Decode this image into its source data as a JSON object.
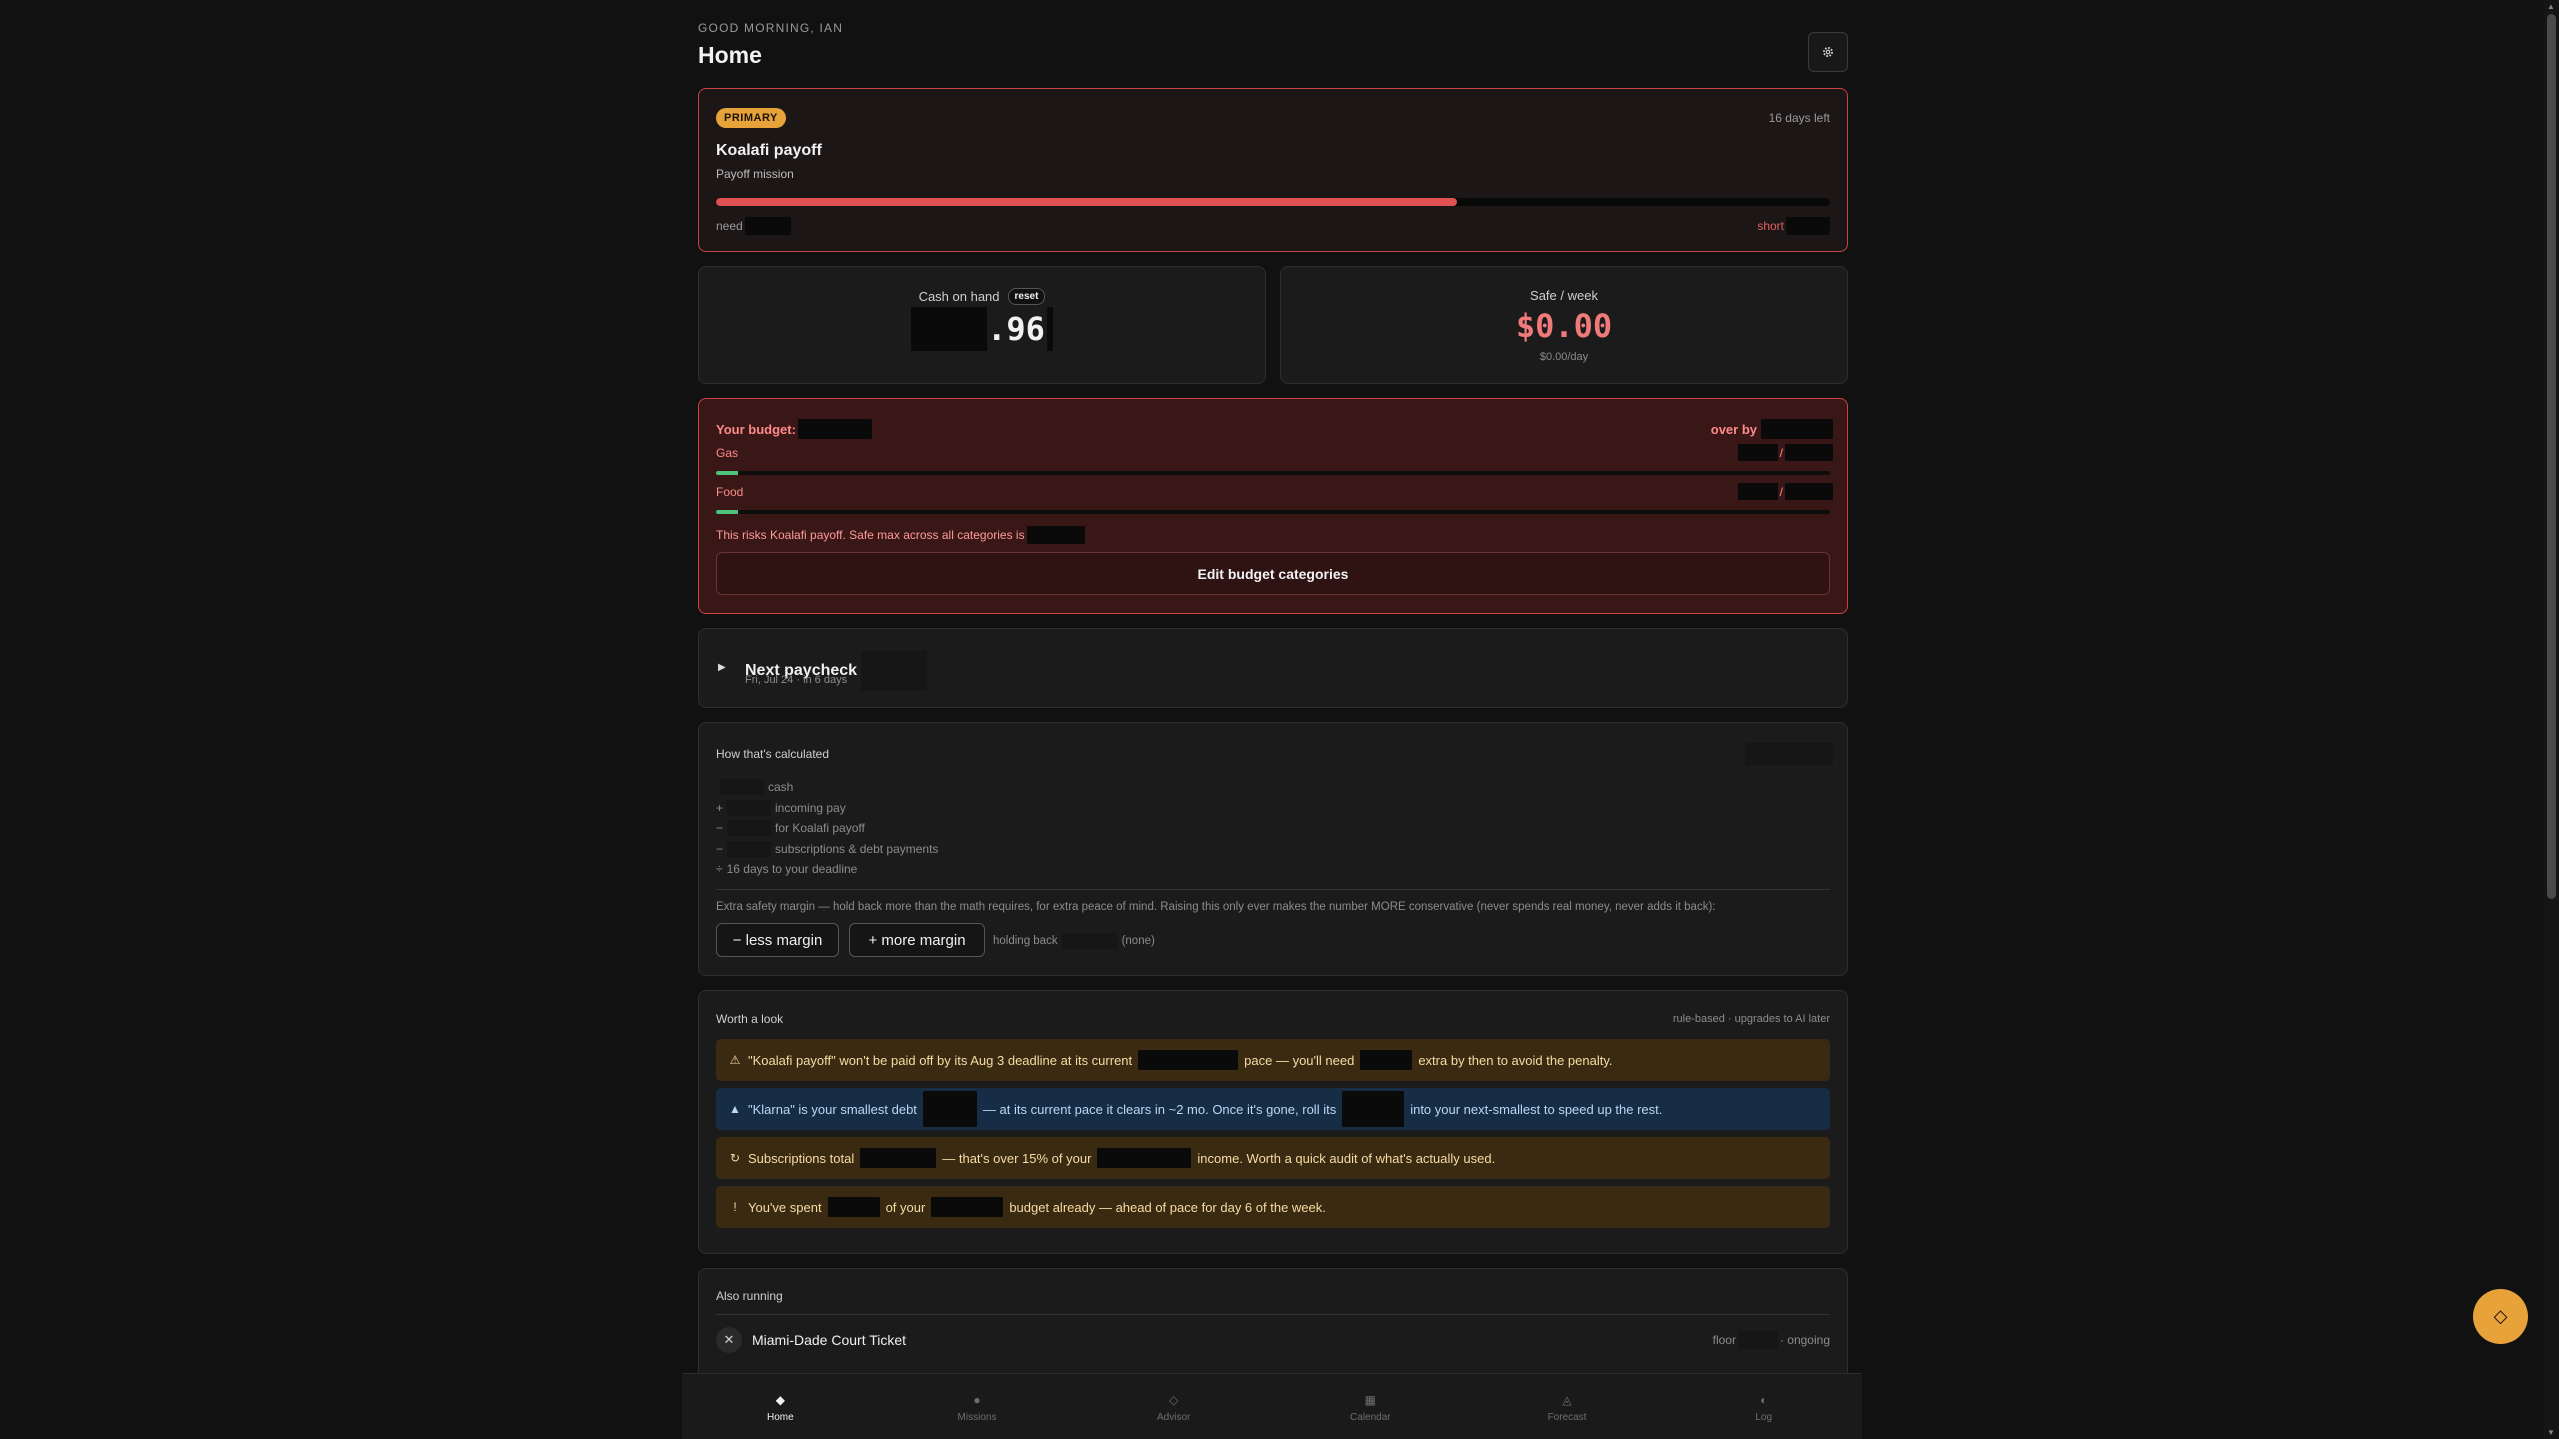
{
  "header": {
    "greeting": "GOOD MORNING, IAN",
    "title": "Home",
    "settings_icon": "gear-icon"
  },
  "primary": {
    "badge": "PRIMARY",
    "days_left": "16 days left",
    "name": "Koalafi payoff",
    "subtitle": "Payoff mission",
    "progress": 0.665,
    "need_label": "need",
    "short_label": "short"
  },
  "cash": {
    "label": "Cash on hand",
    "reset": "reset",
    "value_suffix": ".96"
  },
  "safe": {
    "label": "Safe / week",
    "value": "$0.00",
    "per_day": "$0.00/day"
  },
  "budget": {
    "heading": "Your budget:",
    "over_by": "over by",
    "categories": [
      {
        "name": "Gas",
        "fill": 0.02
      },
      {
        "name": "Food",
        "fill": 0.02
      }
    ],
    "risk_text": "This risks Koalafi payoff. Safe max across all categories is",
    "edit_button": "Edit budget categories"
  },
  "paycheck": {
    "arrow_icon": "triangle-right-icon",
    "title": "Next paycheck",
    "subtitle": "Fri, Jul 24 · in 6 days"
  },
  "calc": {
    "title": "How that's calculated",
    "lines": [
      {
        "sign": "",
        "text": "cash"
      },
      {
        "sign": "+",
        "text": "incoming pay"
      },
      {
        "sign": "−",
        "text": "for Koalafi payoff"
      },
      {
        "sign": "−",
        "text": "subscriptions & debt payments"
      },
      {
        "sign": "÷",
        "text": "16 days to your deadline"
      }
    ],
    "margin_note": "Extra safety margin — hold back more than the math requires, for extra peace of mind. Raising this only ever makes the number MORE conservative (never spends real money, never adds it back):",
    "less_margin": "− less margin",
    "more_margin": "+ more margin",
    "holding_back": "holding back",
    "none": "(none)"
  },
  "worth": {
    "title": "Worth a look",
    "tag": "rule-based · upgrades to AI later",
    "alerts": [
      {
        "kind": "warn",
        "icon": "⚠",
        "a": "\"Koalafi payoff\" won't be paid off by its Aug 3 deadline at its current",
        "b": "pace — you'll need",
        "c": "extra by then to avoid the penalty."
      },
      {
        "kind": "info",
        "icon": "▲",
        "a": "\"Klarna\" is your smallest debt",
        "b": "— at its current pace it clears in ~2 mo. Once it's gone, roll its",
        "c": "into your next-smallest to speed up the rest."
      },
      {
        "kind": "warn",
        "icon": "↻",
        "a": "Subscriptions total",
        "b": "— that's over 15% of your",
        "c": "income. Worth a quick audit of what's actually used."
      },
      {
        "kind": "warn",
        "icon": "!",
        "a": "You've spent",
        "b": "of your",
        "c": "budget already — ahead of pace for day 6 of the week."
      }
    ]
  },
  "also": {
    "title": "Also running",
    "rows": [
      {
        "name": "Miami-Dade Court Ticket",
        "floor": "floor",
        "status": "· ongoing"
      }
    ]
  },
  "nav": [
    {
      "label": "Home",
      "icon": "◆",
      "active": true
    },
    {
      "label": "Missions",
      "icon": "●",
      "active": false
    },
    {
      "label": "Advisor",
      "icon": "◇",
      "active": false
    },
    {
      "label": "Calendar",
      "icon": "▦",
      "active": false
    },
    {
      "label": "Forecast",
      "icon": "◬",
      "active": false
    },
    {
      "label": "Log",
      "icon": "◐",
      "active": false
    }
  ],
  "fab": {
    "icon": "◇"
  },
  "colors": {
    "accent": "#e8a23a",
    "danger": "#e05252",
    "ok": "#4cc27a",
    "bg": "#111111"
  }
}
